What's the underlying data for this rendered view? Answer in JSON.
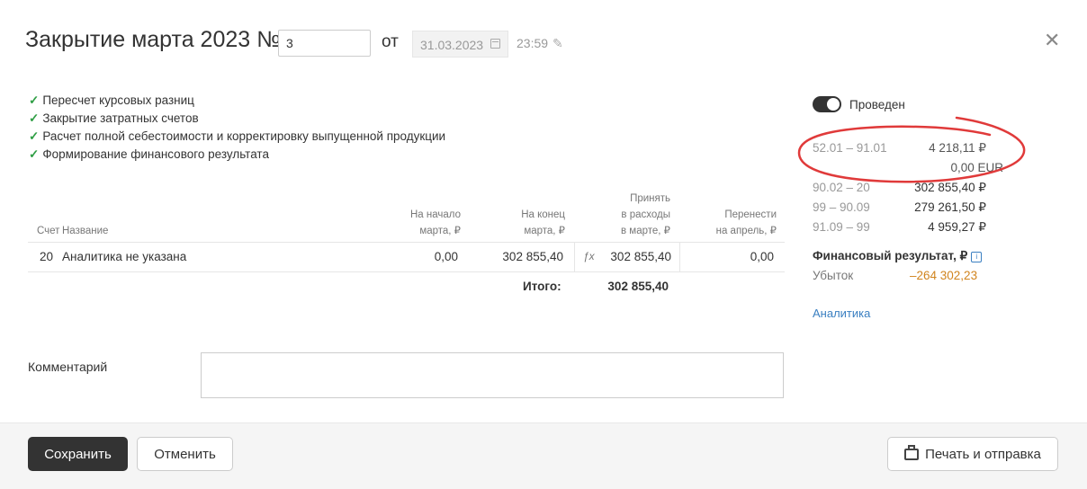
{
  "header": {
    "title": "Закрытие марта 2023 №",
    "number_value": "3",
    "from_label": "от",
    "date_value": "31.03.2023",
    "time_value": "23:59"
  },
  "steps": [
    "Пересчет курсовых разниц",
    "Закрытие затратных счетов",
    "Расчет полной себестоимости и корректировку выпущенной продукции",
    "Формирование финансового результата"
  ],
  "table": {
    "headers": {
      "account": "Счет",
      "name": "Название",
      "start_1": "На начало",
      "start_2": "марта, ₽",
      "end_1": "На конец",
      "end_2": "марта, ₽",
      "accept_1": "Принять",
      "accept_2": "в расходы",
      "accept_3": "в марте, ₽",
      "transfer_1": "Перенести",
      "transfer_2": "на апрель, ₽"
    },
    "rows": [
      {
        "account": "20",
        "name": "Аналитика не указана",
        "start": "0,00",
        "end": "302 855,40",
        "accept": "302 855,40",
        "transfer": "0,00"
      }
    ],
    "total_label": "Итого:",
    "total_end": "302 855,40",
    "total_accept": "302 855,40"
  },
  "comment": {
    "label": "Комментарий",
    "value": ""
  },
  "footer": {
    "save": "Сохранить",
    "cancel": "Отменить",
    "print": "Печать и отправка"
  },
  "side": {
    "posted_label": "Проведен",
    "entries": [
      {
        "account": "52.01 – 91.01",
        "amount": "4 218,11 ₽"
      },
      {
        "account": "",
        "amount": "0,00 EUR"
      },
      {
        "account": "90.02 – 20",
        "amount": "302 855,40 ₽"
      },
      {
        "account": "99 – 90.09",
        "amount": "279 261,50 ₽"
      },
      {
        "account": "91.09 – 99",
        "amount": "4 959,27 ₽"
      }
    ],
    "fin_title": "Финансовый результат, ₽",
    "loss_label": "Убыток",
    "loss_value": "–264 302,23",
    "analytics_link": "Аналитика"
  },
  "colors": {
    "accent": "#3a7fc1",
    "loss": "#d1841e",
    "check": "#2e9e44",
    "annotation": "#e03a3a",
    "dark_button": "#333333"
  }
}
